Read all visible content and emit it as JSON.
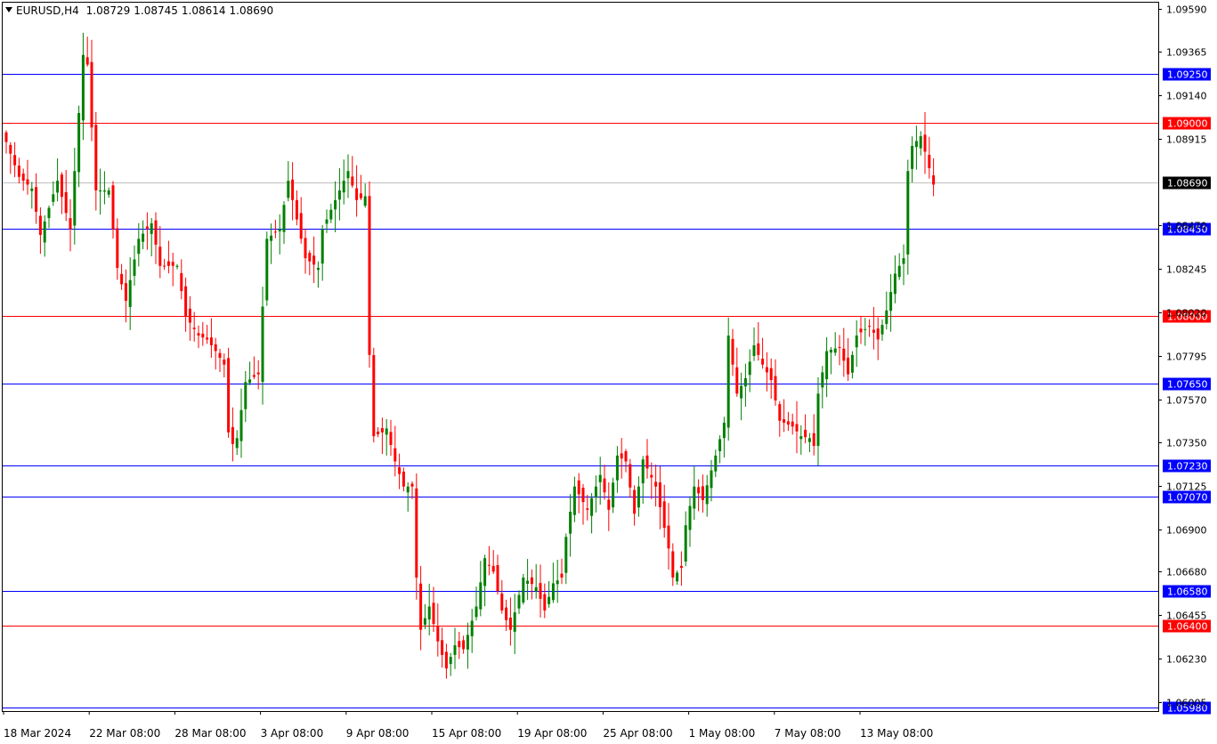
{
  "header": {
    "symbol": "EURUSD,H4",
    "open": "1.08729",
    "high": "1.08745",
    "low": "1.08614",
    "close": "1.08690"
  },
  "chart_data": {
    "type": "candlestick",
    "symbol": "EURUSD",
    "timeframe": "H4",
    "current_price": "1.08690",
    "y_range": [
      1.0596,
      1.0962
    ],
    "y_ticks": [
      "1.09590",
      "1.09365",
      "1.09140",
      "1.08915",
      "1.08470",
      "1.08245",
      "1.08020",
      "1.07795",
      "1.07570",
      "1.07350",
      "1.07125",
      "1.06900",
      "1.06680",
      "1.06455",
      "1.06230",
      "1.06005"
    ],
    "x_labels": [
      "18 Mar 2024",
      "22 Mar 08:00",
      "28 Mar 08:00",
      "3 Apr 08:00",
      "9 Apr 08:00",
      "15 Apr 08:00",
      "19 Apr 08:00",
      "25 Apr 08:00",
      "1 May 08:00",
      "7 May 08:00",
      "13 May 08:00"
    ],
    "levels": [
      {
        "price": "1.09250",
        "color": "#0000ff"
      },
      {
        "price": "1.09000",
        "color": "#ff0000"
      },
      {
        "price": "1.08450",
        "color": "#0000ff"
      },
      {
        "price": "1.08000",
        "color": "#ff0000"
      },
      {
        "price": "1.07650",
        "color": "#0000ff"
      },
      {
        "price": "1.07230",
        "color": "#0000ff"
      },
      {
        "price": "1.07070",
        "color": "#0000ff"
      },
      {
        "price": "1.06580",
        "color": "#0000ff"
      },
      {
        "price": "1.06400",
        "color": "#ff0000"
      },
      {
        "price": "1.05980",
        "color": "#0000ff"
      }
    ],
    "anchors": [
      [
        0,
        1.089
      ],
      [
        3,
        1.0872
      ],
      [
        6,
        1.0866
      ],
      [
        8,
        1.0842
      ],
      [
        12,
        1.087
      ],
      [
        15,
        1.0845
      ],
      [
        18,
        1.0935
      ],
      [
        19,
        1.093
      ],
      [
        21,
        1.0865
      ],
      [
        24,
        1.0865
      ],
      [
        26,
        1.0825
      ],
      [
        28,
        1.0808
      ],
      [
        31,
        1.084
      ],
      [
        34,
        1.0848
      ],
      [
        36,
        1.0826
      ],
      [
        40,
        1.0826
      ],
      [
        42,
        1.08
      ],
      [
        45,
        1.079
      ],
      [
        47,
        1.0788
      ],
      [
        49,
        1.0782
      ],
      [
        51,
        1.0775
      ],
      [
        52,
        1.074
      ],
      [
        53,
        1.0734
      ],
      [
        54,
        1.0737
      ],
      [
        56,
        1.0766
      ],
      [
        59,
        1.077
      ],
      [
        61,
        1.084
      ],
      [
        64,
        1.0845
      ],
      [
        66,
        1.087
      ],
      [
        68,
        1.085
      ],
      [
        70,
        1.083
      ],
      [
        73,
        1.0825
      ],
      [
        74,
        1.0845
      ],
      [
        77,
        1.086
      ],
      [
        80,
        1.0875
      ],
      [
        82,
        1.086
      ],
      [
        84,
        1.0862
      ],
      [
        85,
        1.078
      ],
      [
        86,
        1.0738
      ],
      [
        88,
        1.074
      ],
      [
        89,
        1.0742
      ],
      [
        91,
        1.0725
      ],
      [
        93,
        1.0712
      ],
      [
        95,
        1.0712
      ],
      [
        96,
        1.0665
      ],
      [
        97,
        1.0638
      ],
      [
        99,
        1.065
      ],
      [
        101,
        1.0632
      ],
      [
        103,
        1.0618
      ],
      [
        105,
        1.063
      ],
      [
        107,
        1.0628
      ],
      [
        110,
        1.065
      ],
      [
        112,
        1.0675
      ],
      [
        114,
        1.0668
      ],
      [
        116,
        1.0648
      ],
      [
        118,
        1.0638
      ],
      [
        121,
        1.0665
      ],
      [
        124,
        1.066
      ],
      [
        126,
        1.0648
      ],
      [
        128,
        1.0662
      ],
      [
        130,
        1.0665
      ],
      [
        131,
        1.0686
      ],
      [
        133,
        1.0712
      ],
      [
        136,
        1.07
      ],
      [
        139,
        1.0718
      ],
      [
        141,
        1.07
      ],
      [
        143,
        1.0728
      ],
      [
        145,
        1.0725
      ],
      [
        147,
        1.0698
      ],
      [
        149,
        1.0726
      ],
      [
        152,
        1.0712
      ],
      [
        155,
        1.068
      ],
      [
        156,
        1.0665
      ],
      [
        158,
        1.067
      ],
      [
        159,
        1.0692
      ],
      [
        161,
        1.0712
      ],
      [
        163,
        1.0705
      ],
      [
        166,
        1.0728
      ],
      [
        168,
        1.0745
      ],
      [
        169,
        1.079
      ],
      [
        171,
        1.076
      ],
      [
        173,
        1.0768
      ],
      [
        175,
        1.0785
      ],
      [
        177,
        1.0775
      ],
      [
        179,
        1.0767
      ],
      [
        181,
        1.0746
      ],
      [
        184,
        1.0743
      ],
      [
        186,
        1.0738
      ],
      [
        188,
        1.0737
      ],
      [
        189,
        1.0733
      ],
      [
        190,
        1.076
      ],
      [
        192,
        1.0782
      ],
      [
        195,
        1.0784
      ],
      [
        197,
        1.077
      ],
      [
        199,
        1.079
      ],
      [
        202,
        1.0795
      ],
      [
        204,
        1.0788
      ],
      [
        206,
        1.0803
      ],
      [
        208,
        1.0822
      ],
      [
        210,
        1.083
      ],
      [
        211,
        1.0875
      ],
      [
        212,
        1.0888
      ],
      [
        214,
        1.0893
      ],
      [
        215,
        1.0885
      ],
      [
        217,
        1.0868
      ]
    ]
  }
}
